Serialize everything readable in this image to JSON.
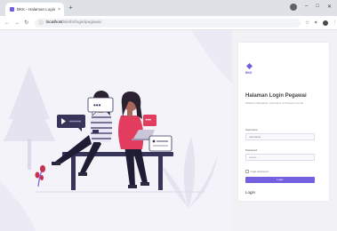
{
  "browser": {
    "tab_title": "BKK - Halaman Login",
    "tab_close": "×",
    "new_tab": "+",
    "url_host": "localhost",
    "url_path": "/siinfo/login/pegawai",
    "controls": [
      "–",
      "□",
      "✕"
    ]
  },
  "login": {
    "logo_text": "BKK",
    "title": "Halaman Login Pegawai",
    "subtitle": "Silahkan Masukkan Username & Password anda",
    "username_label": "Username",
    "username_placeholder": "username",
    "password_label": "Password",
    "password_placeholder": "••••••••",
    "remember_label": "Ingat password",
    "submit_label": "Login",
    "footer_link": "Login"
  },
  "colors": {
    "accent": "#7360df",
    "hero_bg": "#f4f3fa",
    "bubble_red": "#e23c5e"
  },
  "illustration": {
    "dots_bubble": "•••",
    "red_bubble": "•••"
  }
}
